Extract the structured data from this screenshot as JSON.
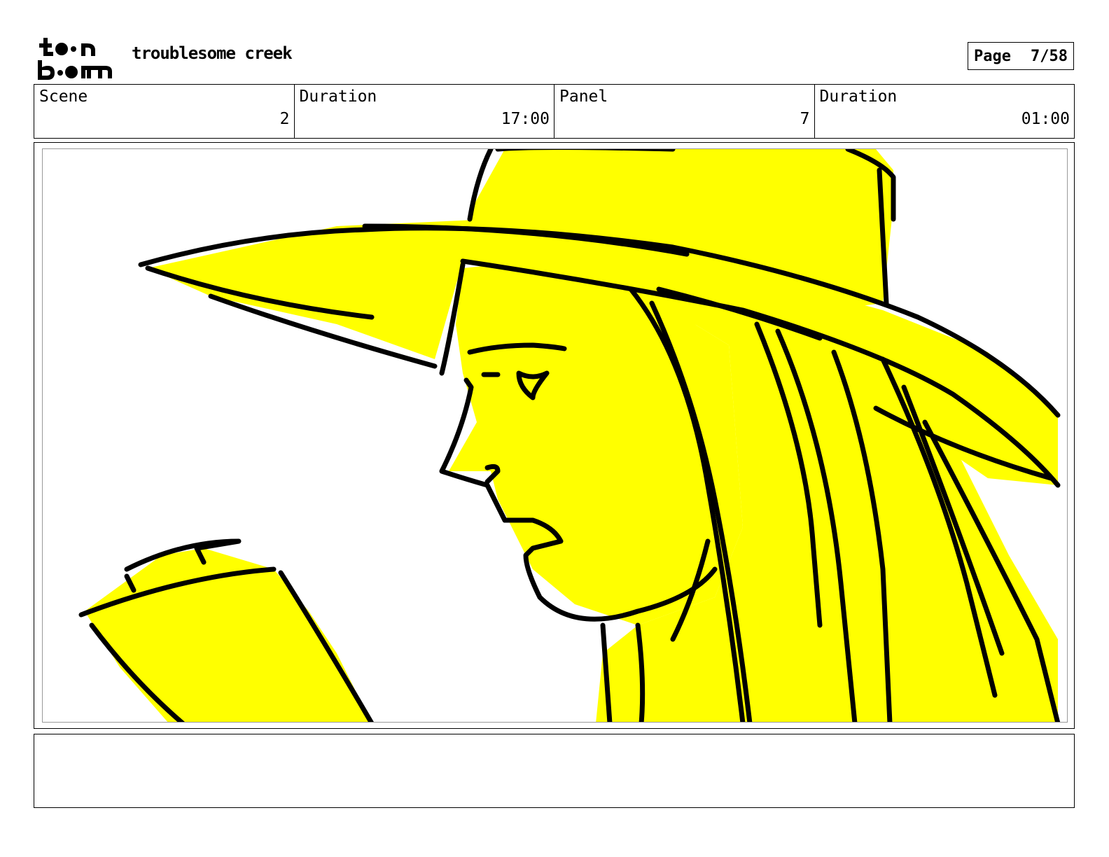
{
  "header": {
    "logo_text": "toon boom",
    "project_title": "troublesome creek",
    "page_label": "Page",
    "page_number": "7/58"
  },
  "info": {
    "scene_label": "Scene",
    "scene_value": "2",
    "scene_duration_label": "Duration",
    "scene_duration_value": "17:00",
    "panel_label": "Panel",
    "panel_value": "7",
    "panel_duration_label": "Duration",
    "panel_duration_value": "01:00"
  },
  "panel": {
    "image_icon": "sketch-girl-in-hat",
    "fill_color": "#ffff00",
    "line_color": "#000000"
  },
  "notes": {
    "text": ""
  }
}
